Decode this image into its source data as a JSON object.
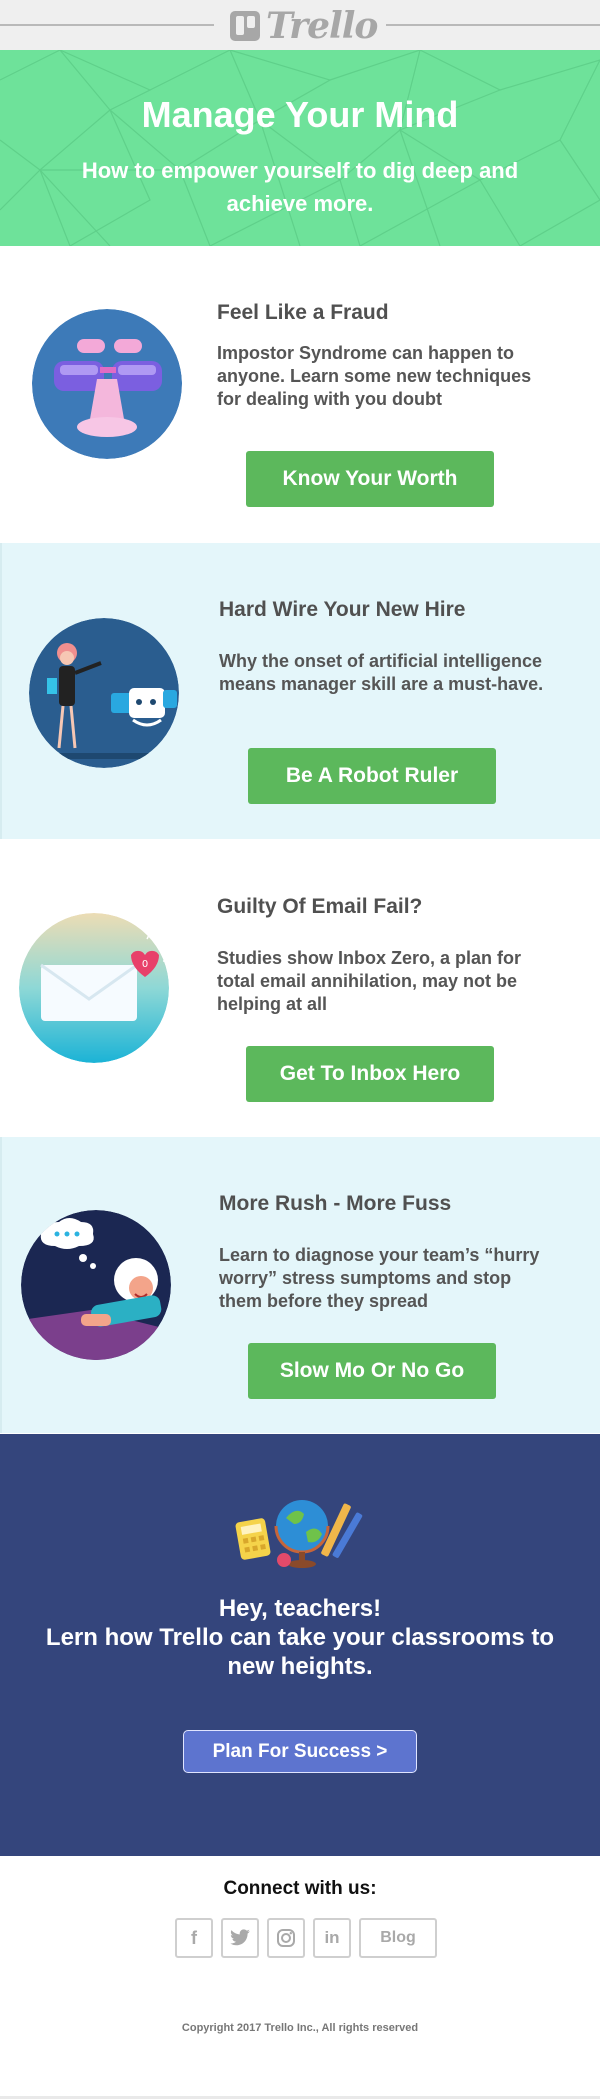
{
  "header": {
    "logo_text": "Trello"
  },
  "hero": {
    "title": "Manage Your Mind",
    "subtitle": "How to empower yourself to dig deep and achieve more."
  },
  "articles": [
    {
      "title": "Feel Like a Fraud",
      "description": "Impostor Syndrome can happen to anyone. Learn some new techniques for dealing with you doubt",
      "button": "Know Your Worth"
    },
    {
      "title": "Hard Wire Your New Hire",
      "description": "Why the onset of artificial intelligence means manager skill are a must-have.",
      "button": "Be A Robot Ruler"
    },
    {
      "title": "Guilty Of Email Fail?",
      "description": "Studies show Inbox Zero, a plan for total email annihilation, may not be helping at all",
      "button": "Get To Inbox Hero"
    },
    {
      "title": "More Rush - More Fuss",
      "description": "Learn to diagnose your team’s “hurry worry” stress sumptoms and stop them before they spread",
      "button": "Slow Mo Or No Go"
    }
  ],
  "teachers": {
    "title": "Hey, teachers!\nLern how Trello can take your classrooms to new heights.",
    "button": "Plan For Success >"
  },
  "footer": {
    "connect": "Connect with us:",
    "social": [
      {
        "label": "f",
        "icon": "facebook-icon"
      },
      {
        "label": "twitter",
        "icon": "twitter-icon"
      },
      {
        "label": "instagram",
        "icon": "instagram-icon"
      },
      {
        "label": "in",
        "icon": "linkedin-icon"
      },
      {
        "label": "Blog",
        "icon": "blog-link"
      }
    ],
    "copyright": "Copyright 2017 Trello Inc., All rights reserved"
  },
  "colors": {
    "hero_bg": "#6ee29a",
    "button_green": "#5cb85c",
    "tint_bg": "#e4f6fa",
    "teachers_bg": "#34457c",
    "teachers_button": "#5d74cf"
  }
}
